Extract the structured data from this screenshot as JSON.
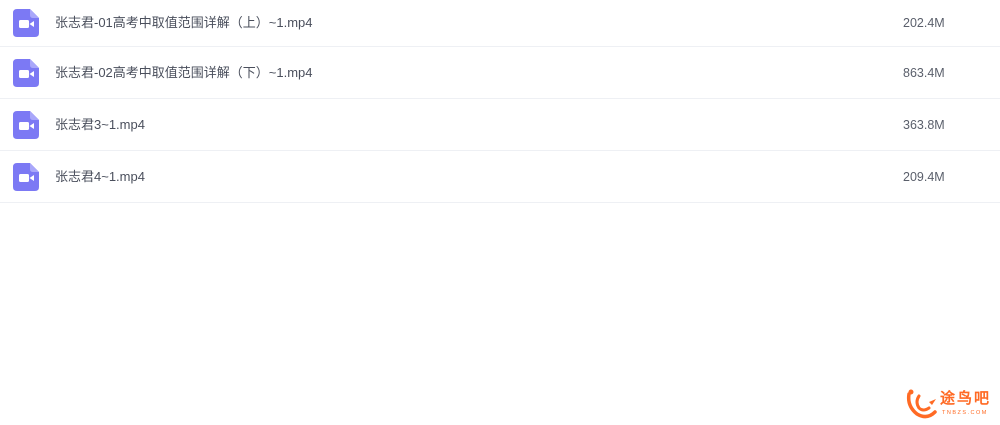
{
  "files": [
    {
      "icon": "video-file-icon",
      "name": "张志君-01高考中取值范围详解（上）~1.mp4",
      "size": "202.4M"
    },
    {
      "icon": "video-file-icon",
      "name": "张志君-02高考中取值范围详解（下）~1.mp4",
      "size": "863.4M"
    },
    {
      "icon": "video-file-icon",
      "name": "张志君3~1.mp4",
      "size": "363.8M"
    },
    {
      "icon": "video-file-icon",
      "name": "张志君4~1.mp4",
      "size": "209.4M"
    }
  ],
  "watermark": {
    "text": "途鸟吧",
    "subtext": "TNBZS.COM"
  },
  "colors": {
    "icon": "#7c79f4",
    "text": "#4a4f5c",
    "divider": "#eef0f4",
    "watermark": "#ff6a24"
  }
}
